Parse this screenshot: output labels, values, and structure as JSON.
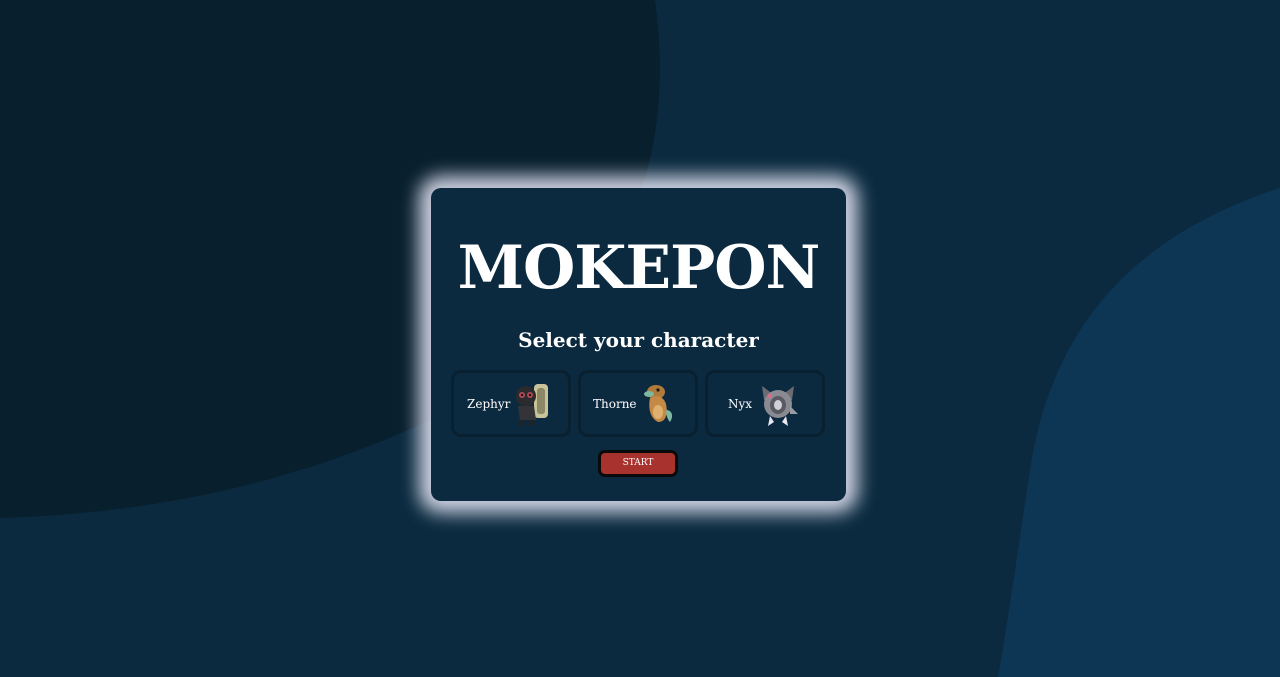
{
  "game": {
    "title": "MOKEPON",
    "subtitle": "Select your character",
    "characters": [
      {
        "name": "Zephyr",
        "icon": "zephyr-sprite-icon"
      },
      {
        "name": "Thorne",
        "icon": "thorne-sprite-icon"
      },
      {
        "name": "Nyx",
        "icon": "nyx-sprite-icon"
      }
    ],
    "start_label": "START"
  },
  "colors": {
    "background": "#0b2a3f",
    "background_dark_blob": "#081f2e",
    "background_light_blob": "#0c3654",
    "card": "#0b2a40",
    "card_glow": "#f0f0ff",
    "option_border": "#08202f",
    "start_button": "#a8322d",
    "text": "#ffffff"
  }
}
